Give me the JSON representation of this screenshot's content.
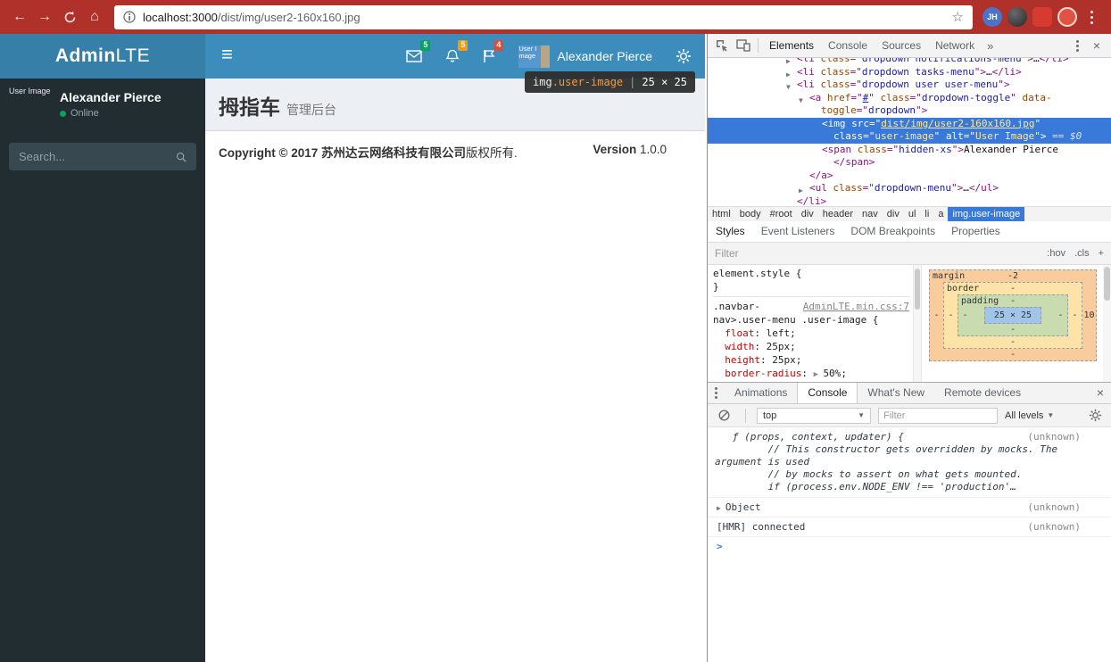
{
  "browser": {
    "back": "←",
    "forward": "→",
    "home": "⌂",
    "url_host": "localhost:3000",
    "url_path": "/dist/img/user2-160x160.jpg",
    "star": "☆",
    "ext_badge": "JH"
  },
  "page": {
    "brand_bold": "Admin",
    "brand_light": "LTE",
    "hamburger": "≡",
    "nav": {
      "messages_badge": "5",
      "notifications_badge": "5",
      "tasks_badge": "4",
      "user_alt": "User Image",
      "user_name": "Alexander Pierce"
    },
    "inspect_tooltip": {
      "tag": "img",
      "cls": ".user-image",
      "sep": "|",
      "size": "25 × 25"
    },
    "sidebar": {
      "user_alt": "User Image",
      "user_name": "Alexander Pierce",
      "user_status": "Online",
      "search_placeholder": "Search..."
    },
    "content": {
      "title": "拇指车",
      "subtitle": "管理后台",
      "copyright_strong": "Copyright © 2017 苏州达云网络科技有限公司",
      "copyright_rest": "版权所有.",
      "version_label": "Version",
      "version_value": "1.0.0"
    }
  },
  "devtools": {
    "tabs": [
      "Elements",
      "Console",
      "Sources",
      "Network"
    ],
    "more_tabs": "»",
    "close": "×",
    "elements_tree": {
      "lines": [
        {
          "d": 0,
          "a": "▶",
          "t": [
            [
              "tag",
              "<li"
            ],
            [
              "attr",
              " class"
            ],
            [
              "tag",
              "=\""
            ],
            [
              "val",
              "dropdown notifications-menu"
            ],
            [
              "tag",
              "\">"
            ],
            [
              "txt",
              "…"
            ],
            [
              "tag",
              "</li>"
            ]
          ]
        },
        {
          "d": 0,
          "a": "▶",
          "t": [
            [
              "tag",
              "<li"
            ],
            [
              "attr",
              " class"
            ],
            [
              "tag",
              "=\""
            ],
            [
              "val",
              "dropdown tasks-menu"
            ],
            [
              "tag",
              "\">"
            ],
            [
              "txt",
              "…"
            ],
            [
              "tag",
              "</li>"
            ]
          ]
        },
        {
          "d": 0,
          "a": "▼",
          "t": [
            [
              "tag",
              "<li"
            ],
            [
              "attr",
              " class"
            ],
            [
              "tag",
              "=\""
            ],
            [
              "val",
              "dropdown user user-menu"
            ],
            [
              "tag",
              "\">"
            ]
          ]
        },
        {
          "d": 1,
          "a": "▼",
          "t": [
            [
              "tag",
              "<a"
            ],
            [
              "attr",
              " href"
            ],
            [
              "tag",
              "=\""
            ],
            [
              "link",
              "#"
            ],
            [
              "tag",
              "\""
            ],
            [
              "attr",
              " class"
            ],
            [
              "tag",
              "=\""
            ],
            [
              "val",
              "dropdown-toggle"
            ],
            [
              "tag",
              "\""
            ],
            [
              "attr",
              " data-"
            ]
          ]
        },
        {
          "d": 1,
          "cont": true,
          "t": [
            [
              "attr",
              "toggle"
            ],
            [
              "tag",
              "=\""
            ],
            [
              "val",
              "dropdown"
            ],
            [
              "tag",
              "\">"
            ]
          ]
        },
        {
          "d": 2,
          "sel": true,
          "t": [
            [
              "tag",
              "<img"
            ],
            [
              "attr",
              " src"
            ],
            [
              "tag",
              "=\""
            ],
            [
              "link",
              "dist/img/user2-160x160.jpg"
            ],
            [
              "tag",
              "\""
            ]
          ]
        },
        {
          "d": 2,
          "sel": true,
          "cont": true,
          "t": [
            [
              "attr",
              "class"
            ],
            [
              "tag",
              "=\""
            ],
            [
              "val",
              "user-image"
            ],
            [
              "tag",
              "\""
            ],
            [
              "attr",
              " alt"
            ],
            [
              "tag",
              "=\""
            ],
            [
              "val",
              "User Image"
            ],
            [
              "tag",
              "\">"
            ],
            [
              "eq",
              " == $0"
            ]
          ]
        },
        {
          "d": 2,
          "t": [
            [
              "tag",
              "<span"
            ],
            [
              "attr",
              " class"
            ],
            [
              "tag",
              "=\""
            ],
            [
              "val",
              "hidden-xs"
            ],
            [
              "tag",
              "\">"
            ],
            [
              "txt",
              "Alexander Pierce"
            ]
          ]
        },
        {
          "d": 2,
          "cont": true,
          "t": [
            [
              "tag",
              "</span>"
            ]
          ]
        },
        {
          "d": 1,
          "t": [
            [
              "tag",
              "</a>"
            ]
          ]
        },
        {
          "d": 1,
          "a": "▶",
          "t": [
            [
              "tag",
              "<ul"
            ],
            [
              "attr",
              " class"
            ],
            [
              "tag",
              "=\""
            ],
            [
              "val",
              "dropdown-menu"
            ],
            [
              "tag",
              "\">"
            ],
            [
              "txt",
              "…"
            ],
            [
              "tag",
              "</ul>"
            ]
          ]
        },
        {
          "d": 0,
          "t": [
            [
              "tag",
              "</li>"
            ]
          ]
        }
      ]
    },
    "breadcrumbs": {
      "items": [
        "html",
        "body",
        "#root",
        "div",
        "header",
        "nav",
        "div",
        "ul",
        "li",
        "a",
        "img.user-image"
      ],
      "selected": "img.user-image"
    },
    "sidebar_tabs": [
      "Styles",
      "Event Listeners",
      "DOM Breakpoints",
      "Properties"
    ],
    "styles": {
      "filter_placeholder": "Filter",
      "hov": ":hov",
      "cls": ".cls",
      "plus": "+",
      "rules": [
        {
          "link": "",
          "lines": [
            [
              [
                "sel",
                "element.style"
              ],
              [
                "b",
                " {"
              ]
            ],
            [
              [
                "b",
                "}"
              ]
            ]
          ]
        },
        {
          "link": "AdminLTE.min.css:7",
          "lines": [
            [
              [
                "sel",
                ".navbar-"
              ]
            ],
            [
              [
                "sel",
                "nav>.user-menu .user-image"
              ],
              [
                "b",
                " {"
              ]
            ],
            [
              [
                "b",
                "  "
              ],
              [
                "prop",
                "float"
              ],
              [
                "b",
                ": "
              ],
              [
                "v",
                "left"
              ],
              [
                "b",
                ";"
              ]
            ],
            [
              [
                "b",
                "  "
              ],
              [
                "prop",
                "width"
              ],
              [
                "b",
                ": "
              ],
              [
                "v",
                "25px"
              ],
              [
                "b",
                ";"
              ]
            ],
            [
              [
                "b",
                "  "
              ],
              [
                "prop",
                "height"
              ],
              [
                "b",
                ": "
              ],
              [
                "v",
                "25px"
              ],
              [
                "b",
                ";"
              ]
            ],
            [
              [
                "b",
                "  "
              ],
              [
                "prop",
                "border-radius"
              ],
              [
                "b",
                ": "
              ],
              [
                "ar",
                "▶ "
              ],
              [
                "v",
                "50%"
              ],
              [
                "b",
                ";"
              ]
            ]
          ]
        }
      ]
    },
    "box_model": {
      "margin_label": "margin",
      "border_label": "border",
      "padding_label": "padding",
      "margin": {
        "top": "-2",
        "right": "10",
        "bottom": "-",
        "left": "-"
      },
      "border": {
        "top": "-",
        "right": "-",
        "bottom": "-",
        "left": "-"
      },
      "padding": {
        "top": "-",
        "right": "-",
        "bottom": "-",
        "left": "-"
      },
      "content": "25 × 25"
    },
    "drawer": {
      "tabs": [
        "Animations",
        "Console",
        "What's New",
        "Remote devices"
      ],
      "active_index": 1,
      "close": "×"
    },
    "console": {
      "context": "top",
      "filter_placeholder": "Filter",
      "levels_label": "All levels",
      "entries": [
        {
          "kind": "func",
          "italic": true,
          "source": "(unknown)",
          "lines": [
            "   ƒ (props, context, updater) {",
            "         // This constructor gets overridden by mocks. The",
            "argument is used",
            "         // by mocks to assert on what gets mounted.",
            "",
            "         if (process.env.NODE_ENV !== 'production'…"
          ]
        },
        {
          "kind": "object",
          "arrow": "▶",
          "text": "Object",
          "source": "(unknown)"
        },
        {
          "kind": "log",
          "text": "[HMR] connected",
          "source": "(unknown)"
        },
        {
          "kind": "prompt",
          "text": ">"
        }
      ]
    },
    "colors": {
      "navbar": "#3c8dbc",
      "logo_bg": "#367fa9",
      "sidebar": "#222d32",
      "chrome": "#b0302a",
      "selection": "#3879d9",
      "badge_green": "#00a65a",
      "badge_yellow": "#f39c12",
      "badge_red": "#dd4b39"
    }
  }
}
